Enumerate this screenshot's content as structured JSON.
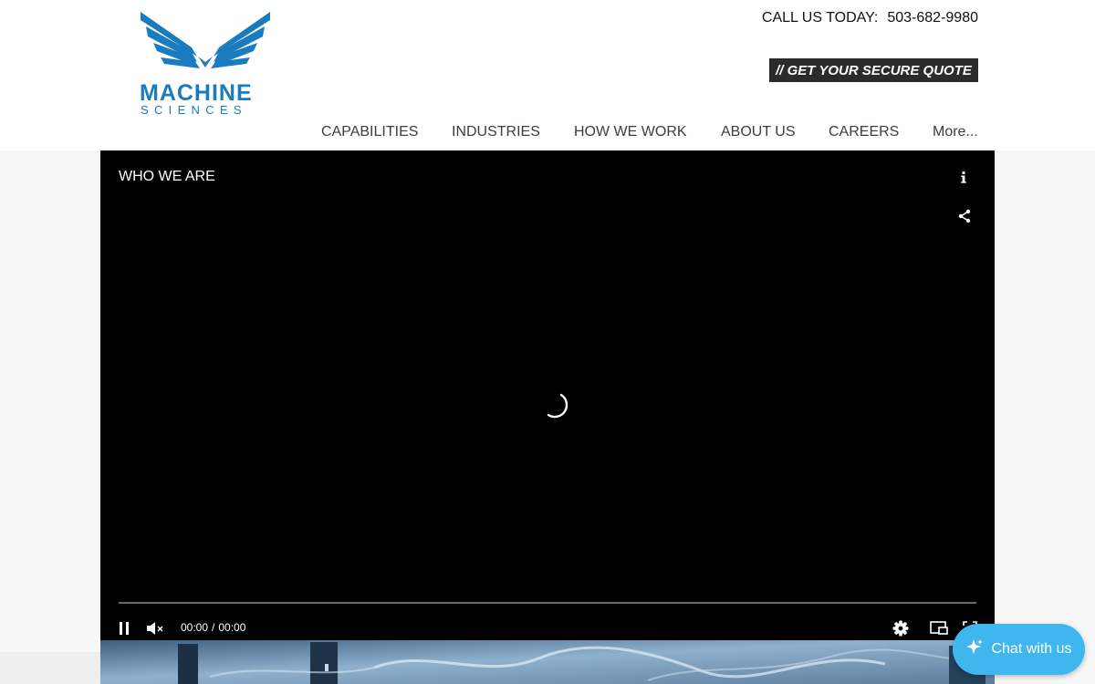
{
  "brand": {
    "name_line1": "MACHINE",
    "name_line2": "SCIENCES",
    "color": "#1b7bbf"
  },
  "header": {
    "call_label": "CALL US TODAY:",
    "phone": "503-682-9980",
    "quote_button": "// GET YOUR SECURE QUOTE",
    "quote_button_bg": "#2b2b2b"
  },
  "nav": {
    "items": [
      "CAPABILITIES",
      "INDUSTRIES",
      "HOW WE WORK",
      "ABOUT US",
      "CAREERS",
      "More..."
    ]
  },
  "video": {
    "title": "WHO WE ARE",
    "current_time": "00:00",
    "separator": "/",
    "duration": "00:00",
    "progress": 0,
    "muted": true,
    "playing": true,
    "icons": [
      "info-icon",
      "share-icon",
      "loading-spinner-icon",
      "pause-icon",
      "mute-icon",
      "settings-icon",
      "picture-in-picture-icon",
      "fullscreen-icon"
    ]
  },
  "chat": {
    "label": "Chat with us",
    "icon": "sparkle-icon",
    "bg": "#3fb6ee"
  }
}
